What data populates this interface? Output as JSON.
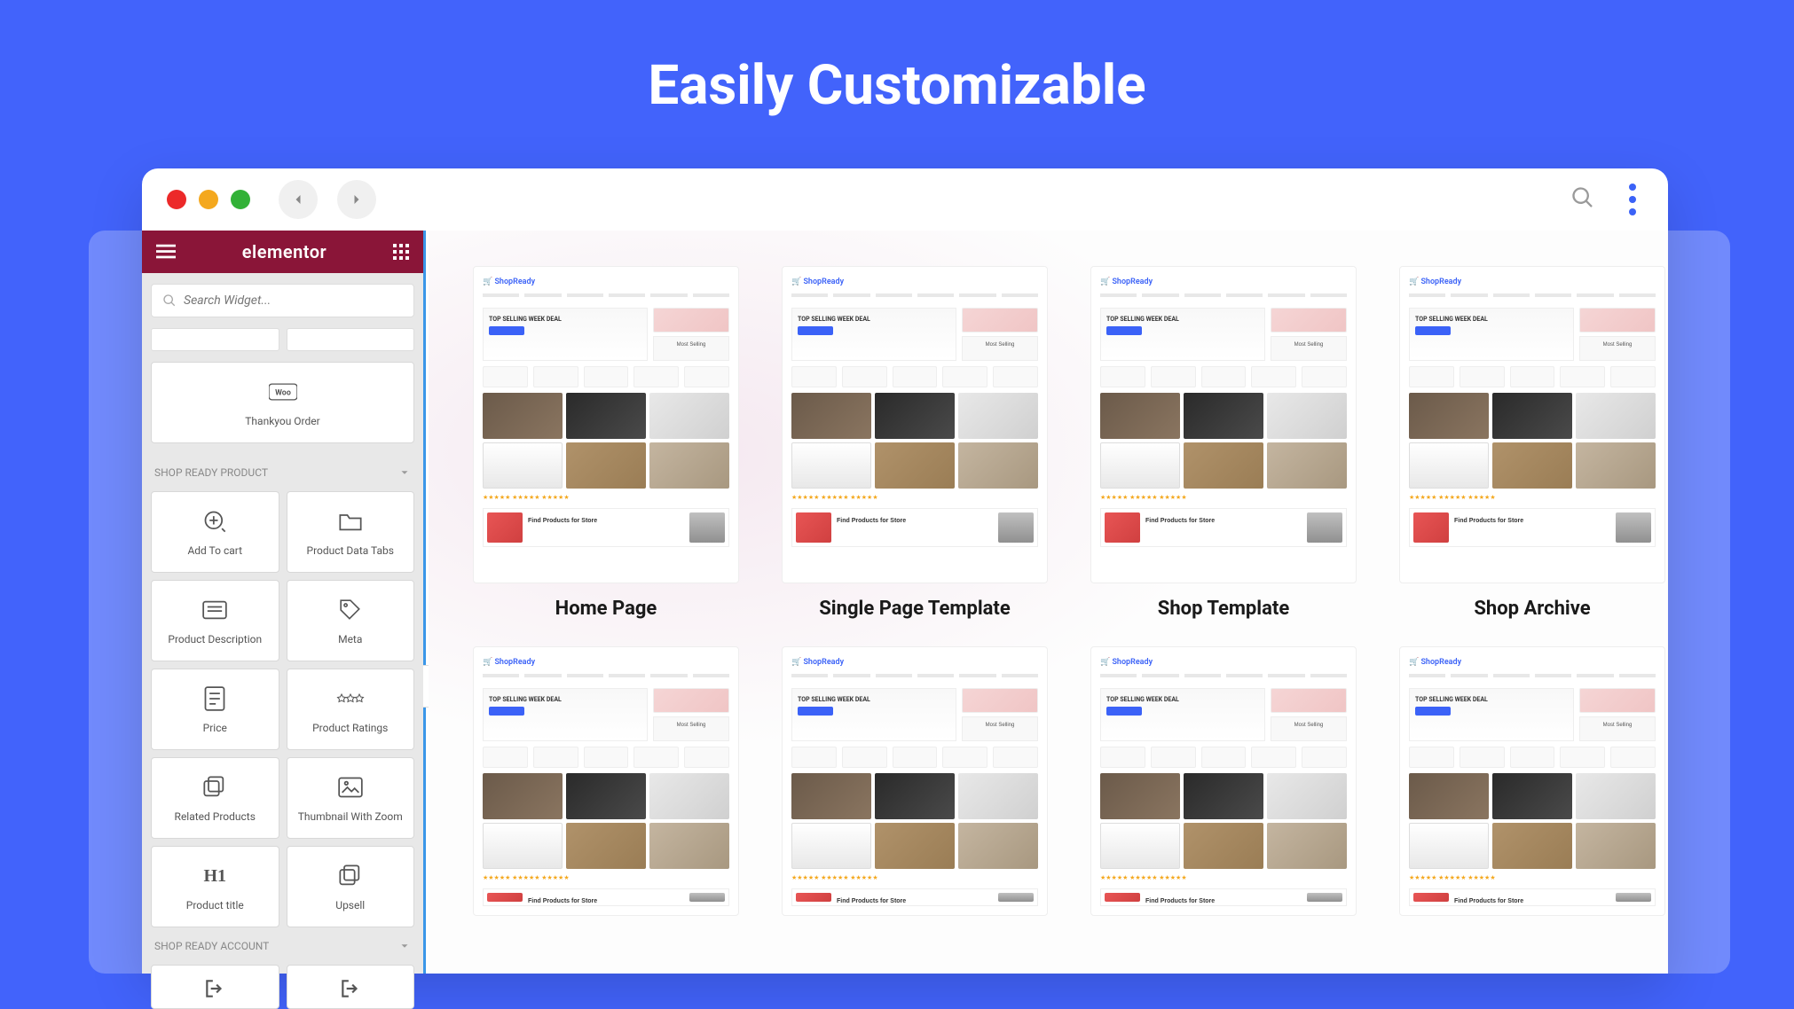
{
  "hero": {
    "title": "Easily Customizable"
  },
  "elementor": {
    "brand": "elementor",
    "search_placeholder": "Search Widget...",
    "widget_thankyou": "Thankyou Order",
    "section_product": "SHOP READY PRODUCT",
    "section_account": "SHOP READY ACCOUNT",
    "widgets": [
      {
        "label": "Add To cart"
      },
      {
        "label": "Product Data Tabs"
      },
      {
        "label": "Product Description"
      },
      {
        "label": "Meta"
      },
      {
        "label": "Price"
      },
      {
        "label": "Product Ratings"
      },
      {
        "label": "Related Products"
      },
      {
        "label": "Thumbnail With Zoom"
      },
      {
        "label": "Product title"
      },
      {
        "label": "Upsell"
      }
    ]
  },
  "templates": [
    {
      "name": "Home Page"
    },
    {
      "name": "Single Page Template"
    },
    {
      "name": "Shop Template"
    },
    {
      "name": "Shop Archive"
    }
  ],
  "thumb": {
    "logo": "ShopReady",
    "deal": "TOP SELLING WEEK DEAL",
    "most": "Most Selling",
    "footer_text": "Find Products for Store"
  }
}
